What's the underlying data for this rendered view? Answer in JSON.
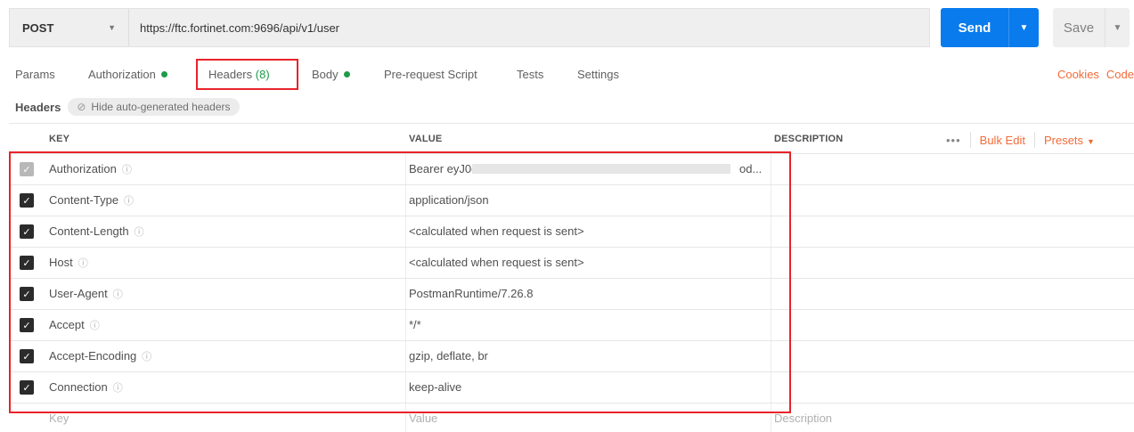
{
  "request": {
    "method": "POST",
    "url": "https://ftc.fortinet.com:9696/api/v1/user"
  },
  "actions": {
    "send_label": "Send",
    "save_label": "Save"
  },
  "tabs": [
    {
      "label": "Params"
    },
    {
      "label": "Authorization",
      "dot": true
    },
    {
      "label": "Headers",
      "count": "(8)",
      "active": true
    },
    {
      "label": "Body",
      "dot": true
    },
    {
      "label": "Pre-request Script"
    },
    {
      "label": "Tests"
    },
    {
      "label": "Settings"
    }
  ],
  "right_links": {
    "cookies": "Cookies",
    "code": "Code"
  },
  "headers_section": {
    "title": "Headers",
    "hide_auto_label": "Hide auto-generated headers"
  },
  "table": {
    "columns": {
      "key": "KEY",
      "value": "VALUE",
      "description": "DESCRIPTION"
    },
    "actions": {
      "more": "•••",
      "bulk_edit": "Bulk Edit",
      "presets": "Presets"
    },
    "rows": [
      {
        "key": "Authorization",
        "value_start": "Bearer eyJ0eXA",
        "value_end": "od...",
        "checked": true,
        "muted": true
      },
      {
        "key": "Content-Type",
        "value": "application/json",
        "checked": true
      },
      {
        "key": "Content-Length",
        "value": "<calculated when request is sent>",
        "checked": true
      },
      {
        "key": "Host",
        "value": "<calculated when request is sent>",
        "checked": true
      },
      {
        "key": "User-Agent",
        "value": "PostmanRuntime/7.26.8",
        "checked": true
      },
      {
        "key": "Accept",
        "value": "*/*",
        "checked": true
      },
      {
        "key": "Accept-Encoding",
        "value": "gzip, deflate, br",
        "checked": true
      },
      {
        "key": "Connection",
        "value": "keep-alive",
        "checked": true
      }
    ],
    "placeholders": {
      "key": "Key",
      "value": "Value",
      "description": "Description"
    }
  },
  "colors": {
    "accent_blue": "#097bed",
    "link_orange": "#f26b3a",
    "status_green": "#1d9b4a",
    "highlight_red": "#e8232a"
  }
}
